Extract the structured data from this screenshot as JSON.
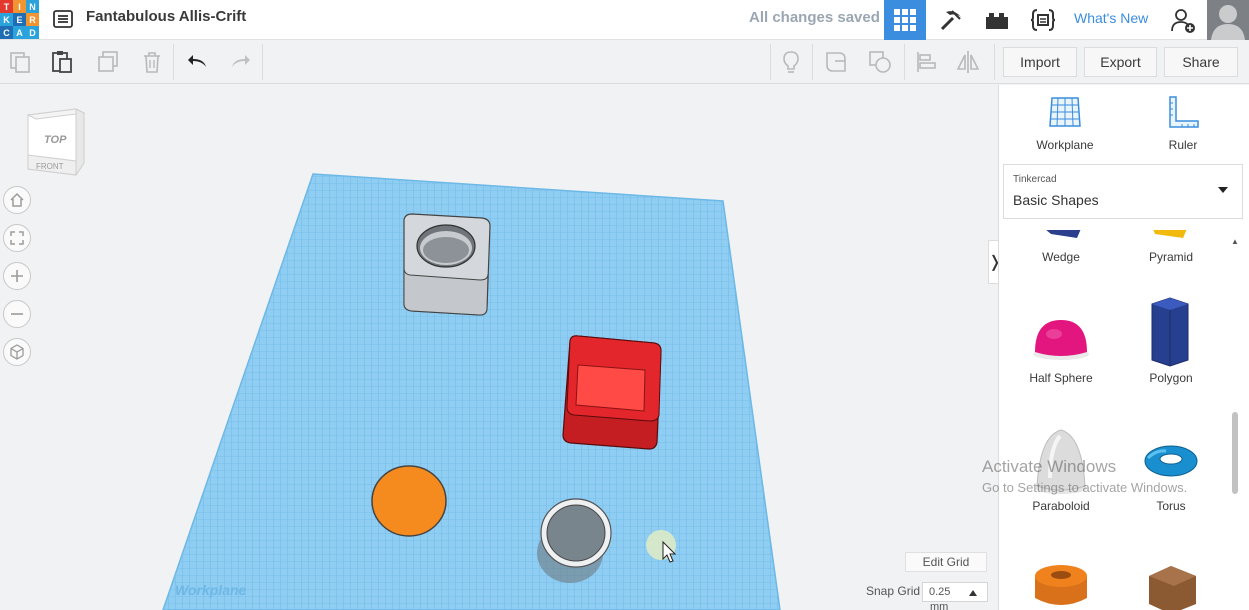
{
  "app": {
    "logo_letters": [
      "T",
      "I",
      "N",
      "K",
      "E",
      "R",
      "C",
      "A",
      "D"
    ],
    "document_title": "Fantabulous Allis-Crift",
    "save_status": "All changes saved",
    "whats_new": "What's New"
  },
  "toolbar": {
    "import_label": "Import",
    "export_label": "Export",
    "share_label": "Share"
  },
  "viewcube": {
    "top_label": "TOP",
    "front_label": "FRONT"
  },
  "canvas": {
    "workplane_label": "Workplane",
    "edit_grid_label": "Edit Grid",
    "snap_grid_label": "Snap Grid",
    "snap_grid_value": "0.25",
    "snap_grid_unit": "mm",
    "activate_title": "Activate Windows",
    "activate_sub": "Go to Settings to activate Windows."
  },
  "panel": {
    "workplane_label": "Workplane",
    "ruler_label": "Ruler",
    "library_small": "Tinkercad",
    "library_selected": "Basic Shapes",
    "shapes": [
      {
        "name": "Wedge"
      },
      {
        "name": "Pyramid"
      },
      {
        "name": "Half Sphere"
      },
      {
        "name": "Polygon"
      },
      {
        "name": "Paraboloid"
      },
      {
        "name": "Torus"
      },
      {
        "name": ""
      },
      {
        "name": ""
      }
    ]
  },
  "colors": {
    "accent": "#3a8ddf",
    "workplane": "#8ccaf0",
    "red_box": "#e3262b",
    "orange_disc": "#f58b1f"
  }
}
